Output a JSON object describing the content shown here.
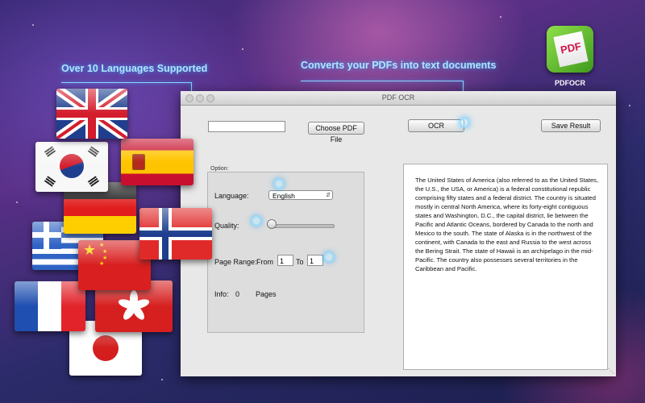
{
  "callouts": {
    "languages": "Over 10 Languages Supported",
    "converts": "Converts your PDFs into text documents"
  },
  "app_icon": {
    "icon_text": "PDF",
    "label": "PDFOCR"
  },
  "window": {
    "title": "PDF OCR",
    "file_path_value": "",
    "choose_button": "Choose PDF File",
    "ocr_button": "OCR",
    "save_button": "Save Result",
    "option_label": "Option:",
    "language_label": "Language:",
    "language_value": "English",
    "quality_label": "Quality:",
    "quality_value": 0,
    "page_range_label": "Page Range:",
    "from_label": "From",
    "from_value": "1",
    "to_label": "To",
    "to_value": "1",
    "info_label": "Info:",
    "info_count": "0",
    "pages_label": "Pages",
    "result_text": "The United States of America (also referred to as the United States, the U.S., the USA, or America) is a federal constitutional republic comprising fifty states and a federal district. The country is situated mostly in central North America, where its forty-eight contiguous states and Washington, D.C., the capital district, lie between the Pacific and Atlantic Oceans, bordered by Canada to the north and Mexico to the south. The state of Alaska is in the northwest of the continent, with Canada to the east and Russia to the west across the Bering Strait. The state of Hawaii is an archipelago in the mid-Pacific. The country also possesses several territories in the Caribbean and Pacific."
  },
  "flags": [
    "united-kingdom",
    "south-korea",
    "spain",
    "germany",
    "greece",
    "norway",
    "china",
    "france",
    "hong-kong",
    "japan"
  ],
  "colors": {
    "callout_text": "#aee6ff",
    "callout_line": "#8fd7ff",
    "icon_green": "#5cbf2a",
    "icon_pdf_text": "#d0144c"
  }
}
